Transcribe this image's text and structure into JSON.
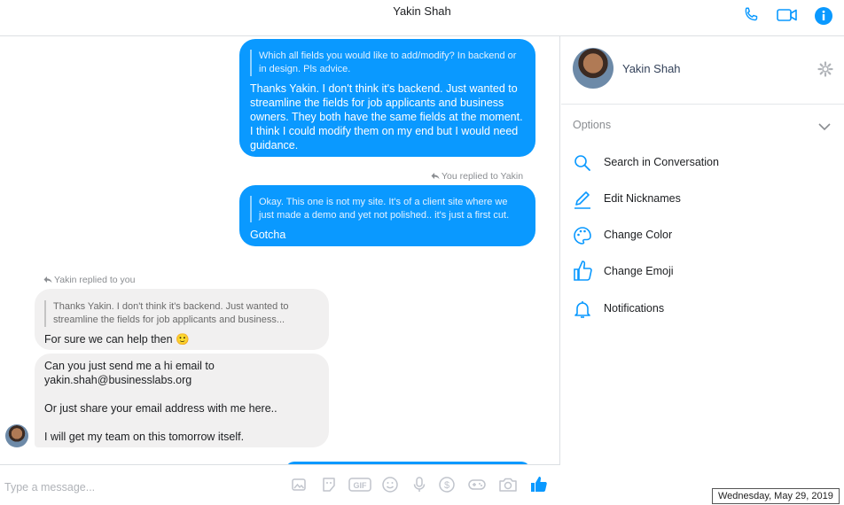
{
  "header": {
    "title": "Yakin Shah"
  },
  "messages": {
    "m1_quote": "Which all fields you would like to add/modify? In backend or in design. Pls advice.",
    "m1_text": "Thanks Yakin. I don't think it's backend. Just wanted to streamline the fields for job applicants and business owners. They both have the same fields at the moment. I think I could modify them on my end but I would need guidance.",
    "reply_meta_1": "You replied to Yakin",
    "m2_quote": "Okay. This one is not my site. It's of a client site where we just made a demo and yet not polished.. it's just a first cut.",
    "m2_text": "Gotcha",
    "reply_meta_2": "Yakin replied to you",
    "m3_quote": "Thanks Yakin. I don't think it's backend. Just wanted to streamline the fields for job applicants and business...",
    "m3_text": "For sure we can help then 🙂",
    "m4_line1": "Can you just send me a hi email to",
    "m4_line2": "yakin.shah@businesslabs.org",
    "m4_line3": "Or just share your email address with me here..",
    "m4_line4": "I will get my team on this tomorrow itself."
  },
  "composer": {
    "placeholder": "Type a message..."
  },
  "sidebar": {
    "name": "Yakin Shah",
    "options_label": "Options",
    "items": [
      {
        "label": "Search in Conversation",
        "icon": "search-icon"
      },
      {
        "label": "Edit Nicknames",
        "icon": "pencil-icon"
      },
      {
        "label": "Change Color",
        "icon": "palette-icon"
      },
      {
        "label": "Change Emoji",
        "icon": "thumbs-up-icon"
      },
      {
        "label": "Notifications",
        "icon": "bell-icon"
      }
    ]
  },
  "tooltip": {
    "date": "Wednesday, May 29, 2019"
  },
  "colors": {
    "accent": "#0a99ff",
    "incoming": "#f1f0f0"
  }
}
